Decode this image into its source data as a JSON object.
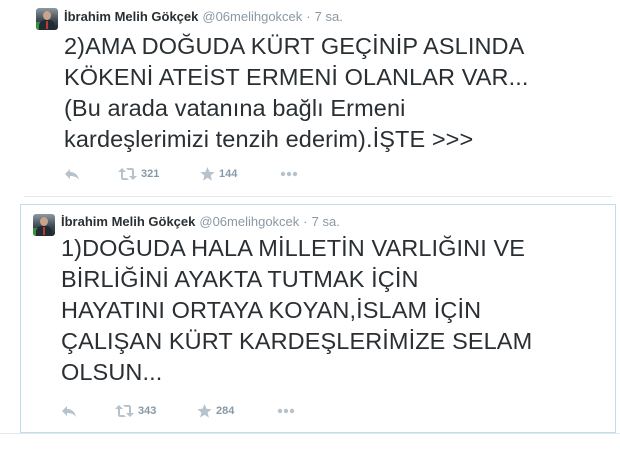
{
  "tweets": [
    {
      "fullname": "İbrahim Melih Gökçek",
      "username": "@06melihgokcek",
      "separator": "·",
      "time": "7 sa.",
      "text": "2)AMA DOĞUDA KÜRT GEÇİNİP ASLINDA\nKÖKENİ ATEİST ERMENİ OLANLAR VAR...\n(Bu arada vatanına bağlı Ermeni\nkardeşlerimizi tenzih ederim).İŞTE >>>",
      "retweets": "321",
      "favorites": "144"
    },
    {
      "fullname": "İbrahim Melih Gökçek",
      "username": "@06melihgokcek",
      "separator": "·",
      "time": "7 sa.",
      "text": "1)DOĞUDA HALA MİLLETİN VARLIĞINI VE\nBİRLİĞİNİ AYAKTA TUTMAK İÇİN\nHAYATINI ORTAYA KOYAN,İSLAM İÇİN\nÇALIŞAN KÜRT KARDEŞLERİMİZE SELAM\nOLSUN...",
      "retweets": "343",
      "favorites": "284"
    }
  ],
  "icons": {
    "avatar": "profile-photo",
    "reply": "reply-icon",
    "retweet": "retweet-icon",
    "favorite": "star-icon",
    "more": "more-dots-icon"
  },
  "colors": {
    "text": "#292f33",
    "meta": "#8899a6",
    "icon": "#b6c2cc",
    "border": "#e1e8ed",
    "highlight_border": "#c0deed"
  }
}
